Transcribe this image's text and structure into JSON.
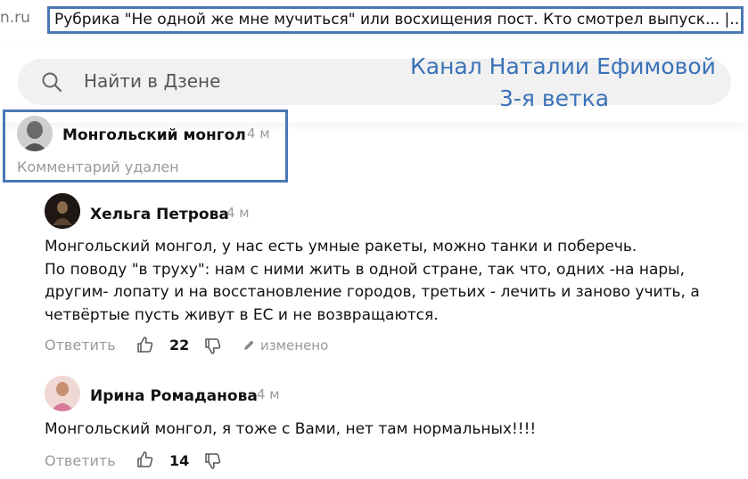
{
  "browser": {
    "url_fragment": "n.ru",
    "title": "Рубрика \"Не одной же мне мучиться\" или восхищения пост. Кто смотрел выпуск... |..."
  },
  "search": {
    "placeholder": "Найти в Дзене"
  },
  "overlay": {
    "line1": "Канал Наталии Ефимовой",
    "line2": "3-я ветка"
  },
  "comments": [
    {
      "author": "Монгольский монгол",
      "time": "4 м",
      "deleted_text": "Комментарий удален"
    },
    {
      "author": "Хельга Петрова",
      "time": "4 м",
      "lines": [
        "Монгольский монгол, у нас есть умные ракеты, можно танки и поберечь.",
        "По поводу \"в труху\": нам с ними жить в одной стране, так что, одних -на нары,",
        "другим- лопату и на восстановление городов, третьих - лечить и заново учить, а",
        "четвёртые пусть живут в ЕС и не возвращаются."
      ],
      "reply": "Ответить",
      "likes": "22",
      "edited": "изменено"
    },
    {
      "author": "Ирина Ромаданова",
      "time": "4 м",
      "lines": [
        "Монгольский монгол, я тоже с Вами, нет там нормальных!!!!"
      ],
      "reply": "Ответить",
      "likes": "14"
    }
  ],
  "colors": {
    "annotation": "#4a78b5",
    "overlay_text": "#3a72b8",
    "muted": "#999999"
  }
}
